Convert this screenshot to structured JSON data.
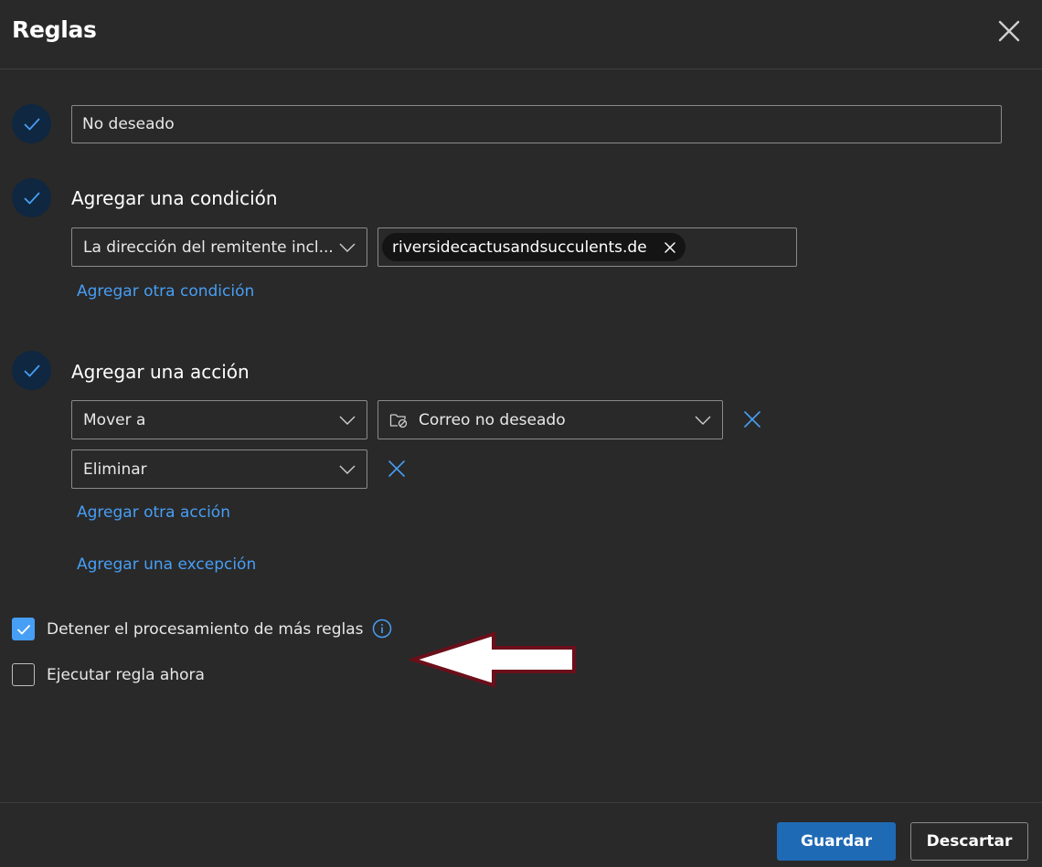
{
  "dialog": {
    "title": "Reglas",
    "close_icon": "close-icon"
  },
  "rule_name": {
    "value": "No deseado"
  },
  "condition": {
    "heading": "Agregar una condición",
    "type_select": "La dirección del remitente incl...",
    "chip_value": "riversidecactusandsucculents.de",
    "add_link": "Agregar otra condición"
  },
  "action": {
    "heading": "Agregar una acción",
    "action1_select": "Mover a",
    "folder_select": "Correo no deseado",
    "action2_select": "Eliminar",
    "add_link": "Agregar otra acción",
    "exception_link": "Agregar una excepción"
  },
  "options": {
    "stop_processing": {
      "label": "Detener el procesamiento de más reglas",
      "checked": true
    },
    "run_now": {
      "label": "Ejecutar regla ahora",
      "checked": false
    }
  },
  "footer": {
    "save_label": "Guardar",
    "discard_label": "Descartar"
  },
  "colors": {
    "background": "#292929",
    "accent_link": "#479ef5",
    "primary_button": "#1f6ab5",
    "step_circle": "#0f2740",
    "annotation_arrow_stroke": "#6b0f1a"
  }
}
